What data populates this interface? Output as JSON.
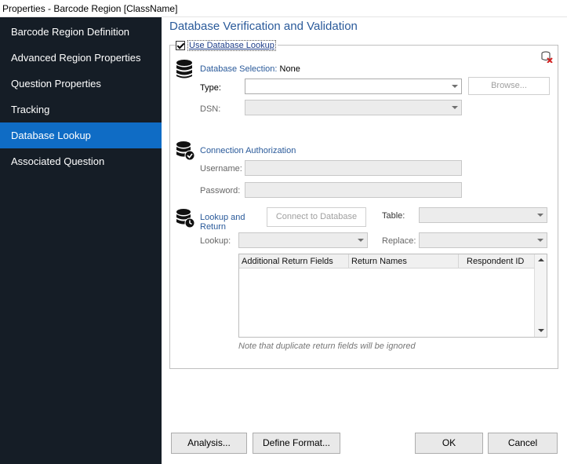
{
  "window": {
    "title": "Properties - Barcode Region [ClassName]"
  },
  "sidebar": {
    "items": [
      {
        "label": "Barcode Region Definition"
      },
      {
        "label": "Advanced Region Properties"
      },
      {
        "label": "Question Properties"
      },
      {
        "label": "Tracking"
      },
      {
        "label": "Database Lookup",
        "active": true
      },
      {
        "label": "Associated Question"
      }
    ]
  },
  "main": {
    "title": "Database Verification and Validation",
    "use_lookup": {
      "label": "Use Database Lookup",
      "checked": true
    },
    "db_selection": {
      "heading": "Database Selection:",
      "value": "None",
      "type_label": "Type:",
      "type_value": "",
      "browse_label": "Browse...",
      "dsn_label": "DSN:",
      "dsn_value": ""
    },
    "auth": {
      "heading": "Connection Authorization",
      "username_label": "Username:",
      "password_label": "Password:"
    },
    "lookup": {
      "heading_line1": "Lookup and",
      "heading_line2": "Return",
      "connect_label": "Connect to Database",
      "table_label": "Table:",
      "lookup_label": "Lookup:",
      "replace_label": "Replace:",
      "columns": [
        "Additional Return Fields",
        "Return Names",
        "Respondent ID"
      ],
      "note": "Note that duplicate return fields will be ignored"
    }
  },
  "footer": {
    "analysis_label": "Analysis...",
    "define_format_label": "Define Format...",
    "ok_label": "OK",
    "cancel_label": "Cancel"
  },
  "colors": {
    "sidebar_bg": "#151d26",
    "active_item": "#0f6cc5",
    "heading": "#2a5a9a"
  }
}
